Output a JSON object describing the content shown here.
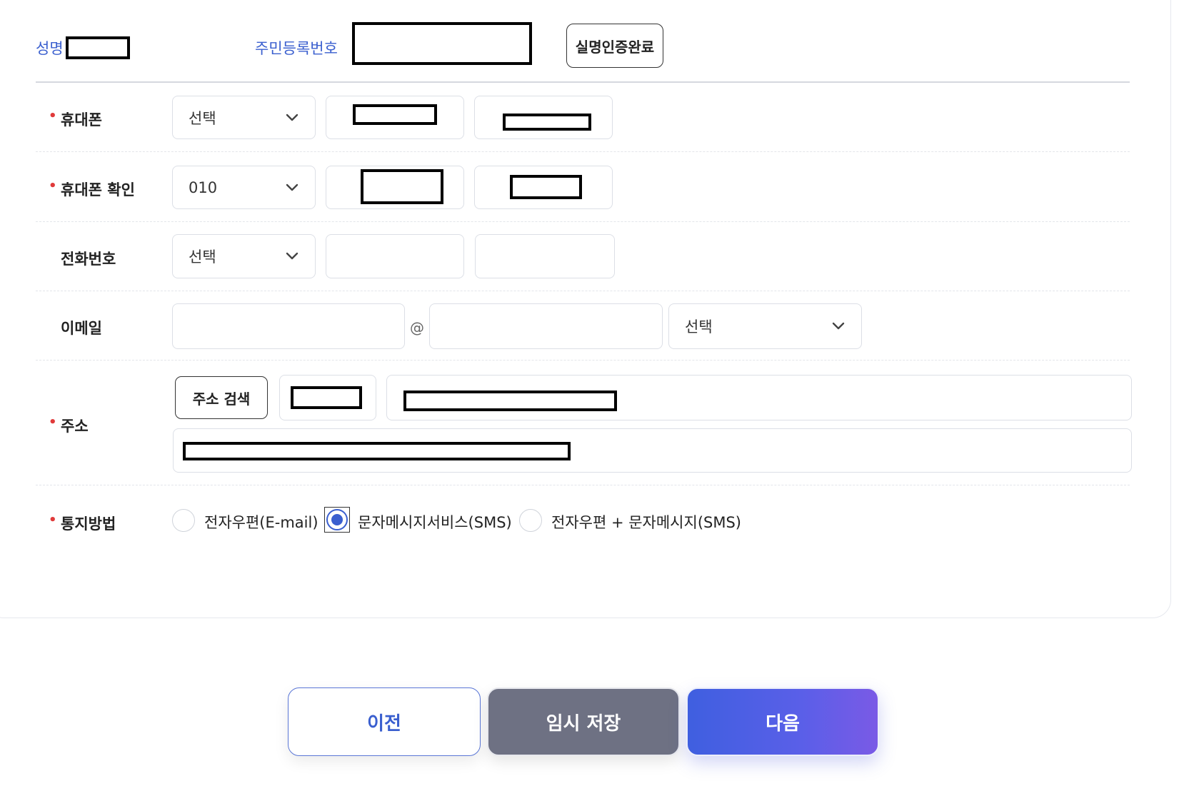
{
  "identity": {
    "name_label": "성명",
    "rrn_label": "주민등록번호",
    "verify_button": "실명인증완료"
  },
  "phone": {
    "label": "휴대폰",
    "required": true,
    "prefix_value": "선택"
  },
  "phone_confirm": {
    "label": "휴대폰 확인",
    "required": true,
    "prefix_value": "010"
  },
  "tel": {
    "label": "전화번호",
    "required": false,
    "prefix_value": "선택"
  },
  "email": {
    "label": "이메일",
    "at_symbol": "@",
    "domain_select_value": "선택"
  },
  "address": {
    "label": "주소",
    "required": true,
    "search_button": "주소 검색"
  },
  "notify": {
    "label": "통지방법",
    "required": true,
    "options": [
      {
        "label": "전자우편(E-mail)",
        "selected": false
      },
      {
        "label": "문자메시지서비스(SMS)",
        "selected": true
      },
      {
        "label": "전자우편 + 문자메시지(SMS)",
        "selected": false
      }
    ]
  },
  "actions": {
    "prev": "이전",
    "temp_save": "임시 저장",
    "next": "다음"
  },
  "required_marker": "•",
  "colors": {
    "accent": "#3a5fcf",
    "required": "#e03a3a",
    "temp_button": "#6e7183"
  }
}
